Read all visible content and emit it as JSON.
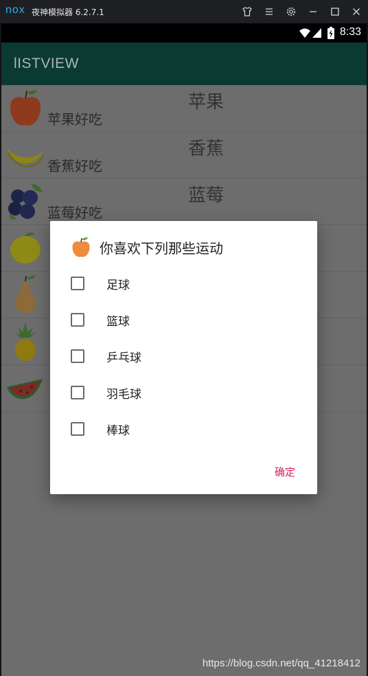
{
  "emulator": {
    "logo": "nox",
    "title": "夜神模拟器 6.2.7.1",
    "buttons": [
      "shirt-icon",
      "menu-icon",
      "gear-icon",
      "minimize-icon",
      "maximize-icon",
      "close-icon"
    ]
  },
  "status_bar": {
    "time": "8:33"
  },
  "app_bar": {
    "title": "lISTVIEW"
  },
  "list": {
    "items": [
      {
        "desc": "苹果好吃",
        "name": "苹果",
        "icon": "apple-icon"
      },
      {
        "desc": "香蕉好吃",
        "name": "香蕉",
        "icon": "banana-icon"
      },
      {
        "desc": "蓝莓好吃",
        "name": "蓝莓",
        "icon": "blueberry-icon"
      },
      {
        "desc": "",
        "name": "",
        "icon": "lemon-icon"
      },
      {
        "desc": "",
        "name": "",
        "icon": "pear-icon"
      },
      {
        "desc": "",
        "name": "",
        "icon": "pineapple-icon"
      },
      {
        "desc": "",
        "name": "",
        "icon": "watermelon-icon"
      }
    ]
  },
  "dialog": {
    "title": "你喜欢下列那些运动",
    "icon": "apple-icon",
    "options": [
      {
        "label": "足球",
        "checked": false
      },
      {
        "label": "篮球",
        "checked": false
      },
      {
        "label": "乒乓球",
        "checked": false
      },
      {
        "label": "羽毛球",
        "checked": false
      },
      {
        "label": "棒球",
        "checked": false
      }
    ],
    "confirm_label": "确定",
    "accent_color": "#d6245e"
  },
  "watermark": "https://blog.csdn.net/qq_41218412"
}
